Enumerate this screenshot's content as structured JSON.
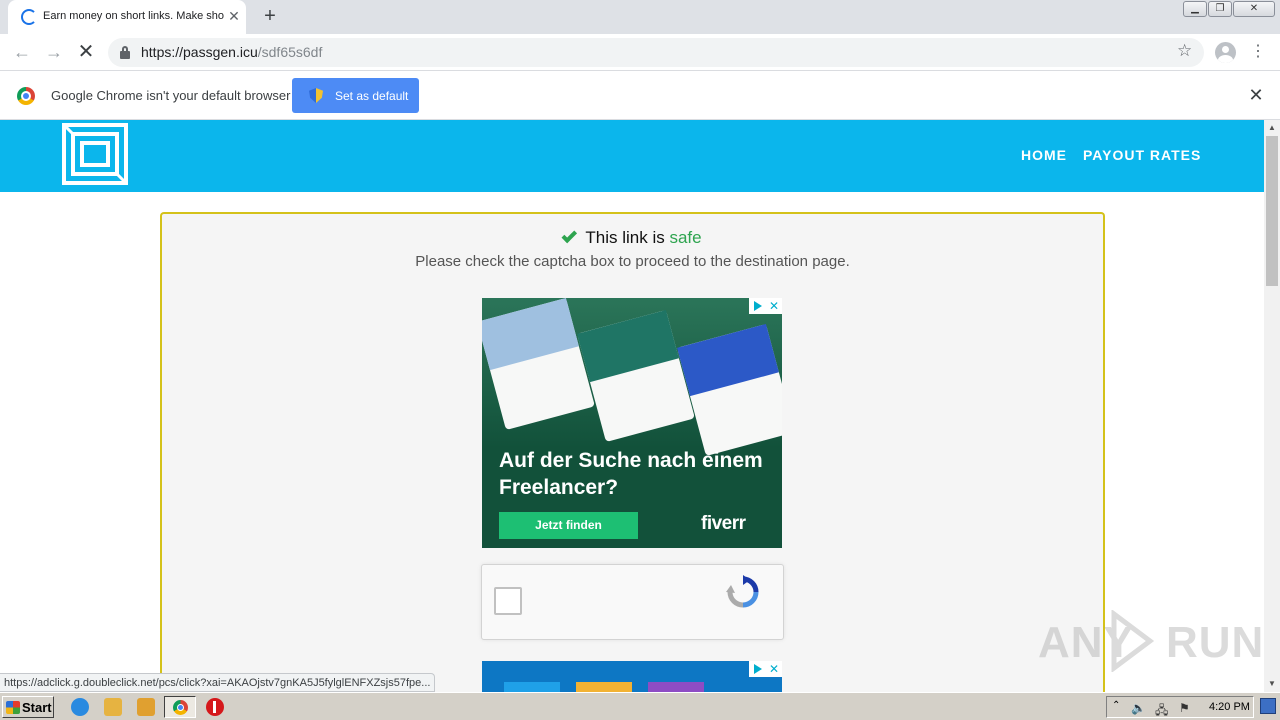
{
  "browser": {
    "tab": {
      "title": "Earn money on short links. Make sho",
      "close_glyph": "✕"
    },
    "new_tab_glyph": "+",
    "window_controls": {
      "minimize": "▁",
      "maximize": "❐",
      "close": "✕"
    },
    "nav": {
      "back": "←",
      "forward": "→",
      "stop": "✕"
    },
    "address": {
      "domain": "https://passgen.icu",
      "path": "/sdf65s6df"
    },
    "bookmark_glyph": "☆",
    "menu_glyph": "⋮",
    "infobar": {
      "message": "Google Chrome isn't your default browser",
      "button_label": "Set as default",
      "close_glyph": "✕"
    },
    "status_url": "https://adclick.g.doubleclick.net/pcs/click?xai=AKAOjstv7gnKA5J5fylglENFXZsjs57fpe..."
  },
  "site": {
    "nav": {
      "home": "HOME",
      "payout_rates": "PAYOUT RATES"
    },
    "safe_prefix": "This link is",
    "safe_word": "safe",
    "instruction": "Please check the captcha box to proceed to the destination page.",
    "ad": {
      "headline": "Auf der Suche nach einem Freelancer?",
      "cta": "Jetzt finden",
      "brand": "fiverr",
      "choices_close": "✕"
    }
  },
  "watermark": {
    "left": "ANY",
    "right": "RUN"
  },
  "taskbar": {
    "start_label": "Start",
    "tray_chevron": "⌃",
    "tray_sound": "🔈",
    "tray_network": "🖧",
    "tray_flag": "⚑",
    "clock": "4:20 PM"
  },
  "colors": {
    "site_header": "#0bb6ec",
    "card_border": "#d4c21a",
    "safe_green": "#2ea44f",
    "ad_background": "#12513a",
    "ad_cta": "#1dbf73",
    "chrome_button": "#4d8bf5"
  },
  "icons": {
    "tab_loading": "loading-spinner-icon",
    "lock": "lock-icon",
    "star": "star-icon",
    "profile": "profile-icon",
    "chrome": "chrome-logo-icon",
    "shield": "uac-shield-icon",
    "check": "checkmark-icon",
    "recaptcha": "recaptcha-icon"
  }
}
